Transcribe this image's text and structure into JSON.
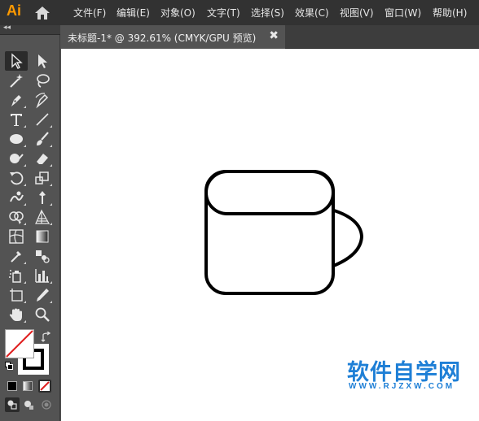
{
  "app": {
    "logo": "Ai"
  },
  "menu": {
    "items": [
      "文件(F)",
      "编辑(E)",
      "对象(O)",
      "文字(T)",
      "选择(S)",
      "效果(C)",
      "视图(V)",
      "窗口(W)",
      "帮助(H)"
    ]
  },
  "panel": {
    "collapse": "◂◂"
  },
  "document": {
    "tab_title": "未标题-1* @ 392.61% (CMYK/GPU 预览)",
    "close_glyph": "✖"
  },
  "tools": [
    "selection-tool",
    "direct-selection-tool",
    "magic-wand-tool",
    "lasso-tool",
    "pen-tool",
    "curvature-tool",
    "type-tool",
    "line-segment-tool",
    "ellipse-tool",
    "paintbrush-tool",
    "shaper-tool",
    "eraser-tool",
    "rotate-tool",
    "scale-tool",
    "warp-tool",
    "free-transform-tool",
    "shape-builder-tool",
    "perspective-grid-tool",
    "mesh-tool",
    "gradient-tool",
    "eyedropper-tool",
    "blend-tool",
    "symbol-sprayer-tool",
    "column-graph-tool",
    "artboard-tool",
    "slice-tool",
    "hand-tool",
    "zoom-tool"
  ],
  "colors": {
    "fill": "none",
    "stroke": "#000000",
    "artwork_stroke": "#000000",
    "watermark": "#1e7fd6"
  },
  "watermark": {
    "text": "软件自学网",
    "url": "WWW.RJZXW.COM"
  }
}
